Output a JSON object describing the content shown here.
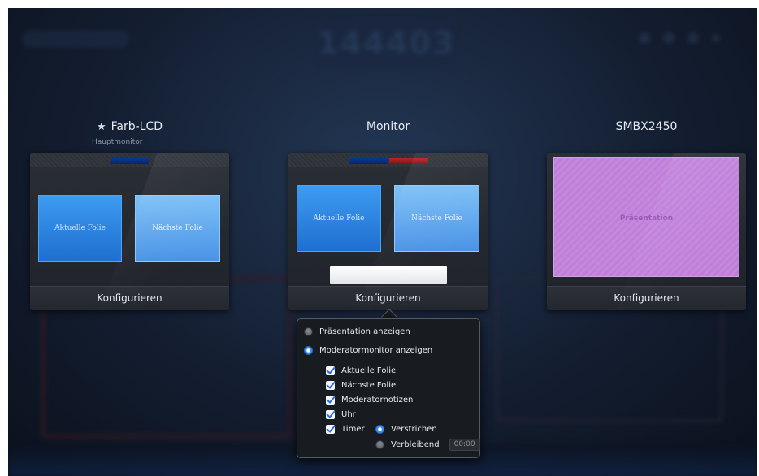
{
  "background": {
    "clock": "144403"
  },
  "monitors": [
    {
      "title": "Farb-LCD",
      "subtitle": "Hauptmonitor",
      "primary": true,
      "slots": [
        "Aktuelle Folie",
        "Nächste Folie"
      ],
      "configure_label": "Konfigurieren"
    },
    {
      "title": "Monitor",
      "slots": [
        "Aktuelle Folie",
        "Nächste Folie"
      ],
      "configure_label": "Konfigurieren"
    },
    {
      "title": "SMBX2450",
      "slots": [
        "Präsentation"
      ],
      "configure_label": "Konfigurieren"
    }
  ],
  "popover": {
    "show_presentation": {
      "label": "Präsentation anzeigen",
      "selected": false
    },
    "show_presenter": {
      "label": "Moderatormonitor anzeigen",
      "selected": true
    },
    "options": [
      {
        "label": "Aktuelle Folie",
        "checked": true
      },
      {
        "label": "Nächste Folie",
        "checked": true
      },
      {
        "label": "Moderatornotizen",
        "checked": true
      },
      {
        "label": "Uhr",
        "checked": true
      },
      {
        "label": "Timer",
        "checked": true
      }
    ],
    "timer_elapsed": {
      "label": "Verstrichen",
      "selected": true
    },
    "timer_remaining": {
      "label": "Verbleibend",
      "selected": false,
      "value": "00:00"
    }
  },
  "colors": {
    "accent_blue": "#2f86e8",
    "presentation_purple": "#c084db",
    "indicator_red": "#c0262c"
  }
}
